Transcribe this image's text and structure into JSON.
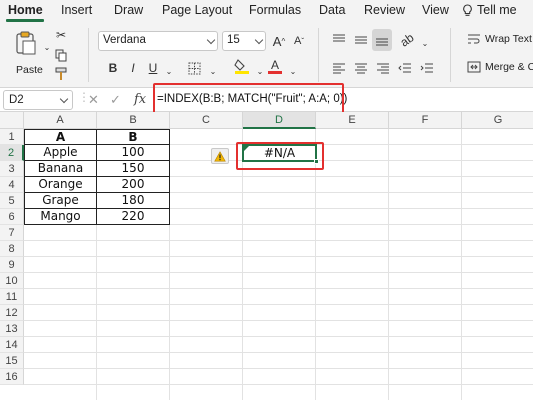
{
  "tabs": [
    "Home",
    "Insert",
    "Draw",
    "Page Layout",
    "Formulas",
    "Data",
    "Review",
    "View"
  ],
  "tell_me": "Tell me",
  "ribbon": {
    "paste_label": "Paste",
    "font_name": "Verdana",
    "font_size": "15",
    "font_grow": "A",
    "font_shrink": "A",
    "bold": "B",
    "italic": "I",
    "underline": "U",
    "font_color_glyph": "A",
    "wrap_text": "Wrap Text",
    "merge_center": "Merge & Ce"
  },
  "formula_bar": {
    "name_box": "D2",
    "fx": "fx",
    "formula": "=INDEX(B:B; MATCH(\"Fruit\"; A:A; 0))"
  },
  "sheet": {
    "columns": [
      "A",
      "B",
      "C",
      "D",
      "E",
      "F",
      "G"
    ],
    "rows": [
      "1",
      "2",
      "3",
      "4",
      "5",
      "6",
      "7",
      "8",
      "9",
      "10",
      "11",
      "12",
      "13",
      "14",
      "15",
      "16"
    ],
    "header_a": "A",
    "header_b": "B",
    "data": [
      {
        "fruit": "Apple",
        "value": "100"
      },
      {
        "fruit": "Banana",
        "value": "150"
      },
      {
        "fruit": "Orange",
        "value": "200"
      },
      {
        "fruit": "Grape",
        "value": "180"
      },
      {
        "fruit": "Mango",
        "value": "220"
      }
    ],
    "selected_cell_value": "#N/A"
  },
  "colors": {
    "accent": "#217346",
    "highlight_red": "#e3302f",
    "warning": "#f2b705"
  }
}
